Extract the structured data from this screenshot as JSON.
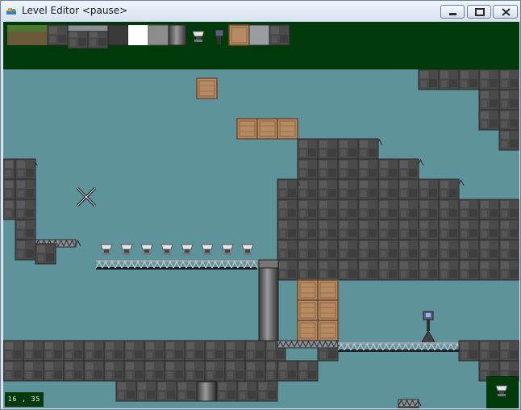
{
  "window": {
    "title": "Level Editor <pause>",
    "buttons": {
      "minimize": "minimize",
      "maximize": "maximize",
      "close": "close"
    }
  },
  "palette": {
    "items": [
      "grass-dirt",
      "dark-stone",
      "girder-stone",
      "metal-dark",
      "white-block",
      "metal-grey",
      "metal-pipe",
      "turret",
      "robot",
      "wooden-crate",
      "steel-plate",
      "stone-block"
    ]
  },
  "editor": {
    "status": "paused",
    "coordinates": "16 , 35",
    "selected_item": "turret"
  },
  "colors": {
    "sky": "#5e939c",
    "panel": "#003a0a",
    "stone": "#4d4d4d",
    "crate": "#b68b63"
  }
}
